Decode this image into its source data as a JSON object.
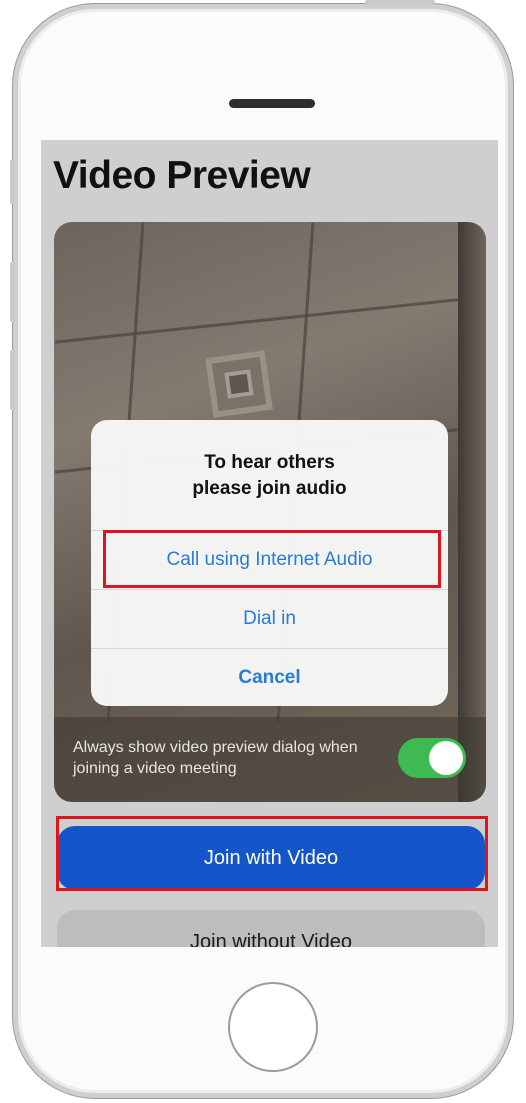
{
  "screen": {
    "title": "Video Preview",
    "toggle": {
      "label": "Always show video preview dialog when joining a video meeting",
      "state": "on",
      "color": "#3dbb52"
    },
    "dialog": {
      "title_line1": "To hear others",
      "title_line2": "please join audio",
      "options": [
        {
          "label": "Call using Internet Audio",
          "highlighted": true
        },
        {
          "label": "Dial in",
          "highlighted": false
        },
        {
          "label": "Cancel",
          "highlighted": false
        }
      ]
    },
    "buttons": {
      "join_with_video": "Join with Video",
      "join_without_video": "Join without Video"
    }
  },
  "colors": {
    "primary_button": "#1456c9",
    "link": "#2a7bd6",
    "highlight_box": "#e0141e"
  },
  "icons": [
    "home-button-icon",
    "speaker-grille-icon"
  ]
}
